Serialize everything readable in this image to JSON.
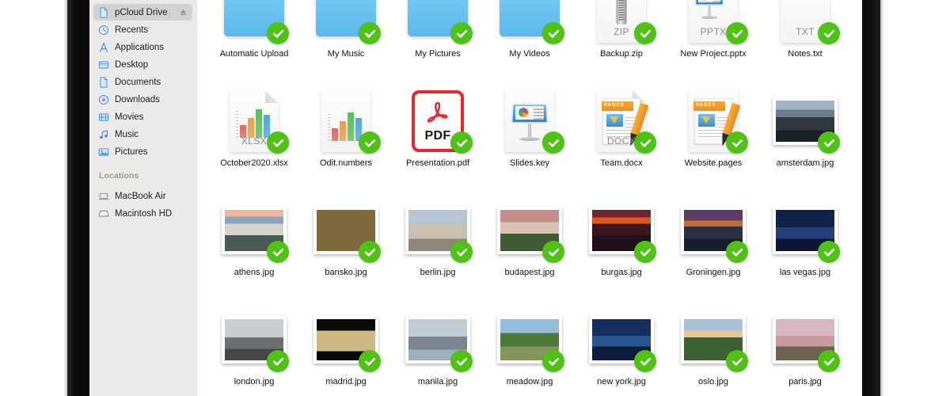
{
  "window": {
    "app": "Finder",
    "current_location": "pCloud Drive"
  },
  "sidebar": {
    "favorites": [
      {
        "label": "pCloud Drive",
        "icon": "document-icon",
        "selected": true,
        "eject": true
      },
      {
        "label": "Recents",
        "icon": "clock-icon",
        "selected": false,
        "eject": false
      },
      {
        "label": "Applications",
        "icon": "applications-icon",
        "selected": false,
        "eject": false
      },
      {
        "label": "Desktop",
        "icon": "desktop-icon",
        "selected": false,
        "eject": false
      },
      {
        "label": "Documents",
        "icon": "document-icon",
        "selected": false,
        "eject": false
      },
      {
        "label": "Downloads",
        "icon": "download-icon",
        "selected": false,
        "eject": false
      },
      {
        "label": "Movies",
        "icon": "movies-icon",
        "selected": false,
        "eject": false
      },
      {
        "label": "Music",
        "icon": "music-note-icon",
        "selected": false,
        "eject": false
      },
      {
        "label": "Pictures",
        "icon": "pictures-icon",
        "selected": false,
        "eject": false
      }
    ],
    "locations_heading": "Locations",
    "locations": [
      {
        "label": "MacBook Air",
        "icon": "laptop-icon"
      },
      {
        "label": "Macintosh HD",
        "icon": "harddrive-icon"
      }
    ]
  },
  "colors": {
    "sidebar_bg": "#eceae8",
    "selected_row": "#d3d1cf",
    "sidebar_icon_blue": "#3b8fe0",
    "sync_badge_green": "#4fc314",
    "folder_blue": "#5bb8ec",
    "pdf_red": "#e8262a",
    "pages_orange": "#ef8f1c",
    "bezel_black": "#0d0d0d"
  },
  "files": [
    {
      "name": "Automatic Upload",
      "kind": "folder",
      "synced": true
    },
    {
      "name": "My Music",
      "kind": "folder",
      "synced": true
    },
    {
      "name": "My Pictures",
      "kind": "folder",
      "synced": true
    },
    {
      "name": "My Videos",
      "kind": "folder",
      "synced": true
    },
    {
      "name": "Backup.zip",
      "kind": "zip",
      "ext": "ZIP",
      "synced": true
    },
    {
      "name": "New Project.pptx",
      "kind": "slides",
      "ext": "PPTX",
      "synced": true
    },
    {
      "name": "Notes.txt",
      "kind": "text",
      "ext": "TXT",
      "synced": true
    },
    {
      "name": "October2020.xlsx",
      "kind": "spreadsheet",
      "ext": "XLSX",
      "synced": true
    },
    {
      "name": "Odit.numbers",
      "kind": "numbers",
      "ext": "",
      "synced": true
    },
    {
      "name": "Presentation.pdf",
      "kind": "pdf",
      "ext": "PDF",
      "synced": true
    },
    {
      "name": "Slides.key",
      "kind": "keynote",
      "ext": "",
      "synced": true
    },
    {
      "name": "Team.docx",
      "kind": "pages",
      "ext": "DOCX",
      "synced": true
    },
    {
      "name": "Website.pages",
      "kind": "pages-plain",
      "ext": "",
      "synced": true
    },
    {
      "name": "amsterdam.jpg",
      "kind": "photo",
      "synced": true,
      "scene": "amsterdam"
    },
    {
      "name": "athens.jpg",
      "kind": "photo",
      "synced": true,
      "scene": "athens"
    },
    {
      "name": "bansko.jpg",
      "kind": "photo",
      "synced": true,
      "scene": "bansko"
    },
    {
      "name": "berlin.jpg",
      "kind": "photo",
      "synced": true,
      "scene": "berlin"
    },
    {
      "name": "budapest.jpg",
      "kind": "photo",
      "synced": true,
      "scene": "budapest"
    },
    {
      "name": "burgas.jpg",
      "kind": "photo",
      "synced": true,
      "scene": "burgas"
    },
    {
      "name": "Groningen.jpg",
      "kind": "photo",
      "synced": true,
      "scene": "groningen"
    },
    {
      "name": "las vegas.jpg",
      "kind": "photo",
      "synced": true,
      "scene": "lasvegas"
    },
    {
      "name": "london.jpg",
      "kind": "photo",
      "synced": true,
      "scene": "london",
      "clipped": true
    },
    {
      "name": "madrid.jpg",
      "kind": "photo",
      "synced": true,
      "scene": "madrid",
      "clipped": true
    },
    {
      "name": "manila.jpg",
      "kind": "photo",
      "synced": true,
      "scene": "manila",
      "clipped": true
    },
    {
      "name": "meadow.jpg",
      "kind": "photo",
      "synced": true,
      "scene": "meadow",
      "clipped": true
    },
    {
      "name": "new york.jpg",
      "kind": "photo",
      "synced": true,
      "scene": "newyork",
      "clipped": true
    },
    {
      "name": "oslo.jpg",
      "kind": "photo",
      "synced": true,
      "scene": "oslo",
      "clipped": true
    },
    {
      "name": "paris.jpg",
      "kind": "photo",
      "synced": true,
      "scene": "paris",
      "clipped": true
    }
  ]
}
